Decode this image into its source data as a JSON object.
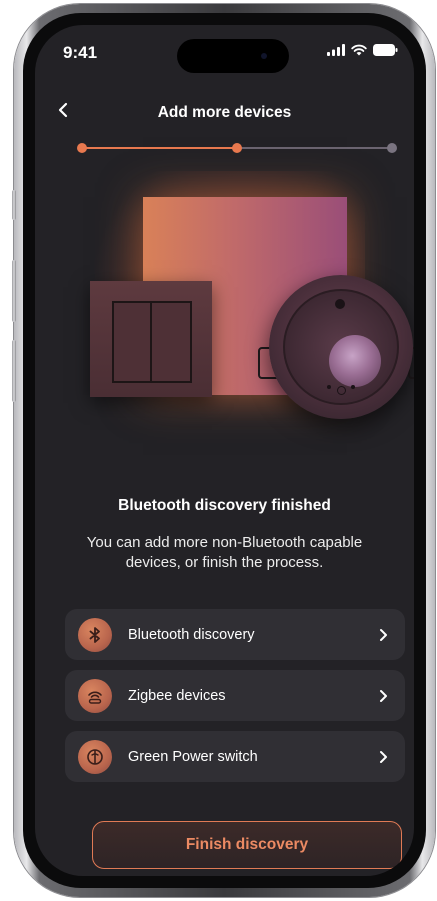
{
  "status_bar": {
    "time": "9:41"
  },
  "header": {
    "title": "Add more devices",
    "back_icon": "chevron-left-icon"
  },
  "stepper": {
    "current_step": 2,
    "total_steps": 3
  },
  "content": {
    "heading": "Bluetooth discovery finished",
    "description": "You can add more non-Bluetooth capable devices, or finish the process."
  },
  "options": [
    {
      "label": "Bluetooth discovery",
      "icon": "bluetooth-icon"
    },
    {
      "label": "Zigbee devices",
      "icon": "zigbee-icon"
    },
    {
      "label": "Green Power switch",
      "icon": "green-power-icon"
    }
  ],
  "actions": {
    "finish_label": "Finish discovery"
  },
  "colors": {
    "accent": "#e8794f",
    "background": "#232226",
    "card": "#302f34"
  }
}
